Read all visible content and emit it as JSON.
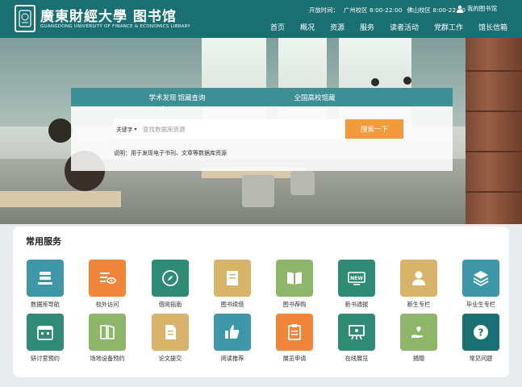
{
  "header": {
    "logo_cn": "廣東財經大學 图书馆",
    "logo_en": "GUANGDONG UNIVERSITY OF FINANCE & ECONOMICS  LIBRARY",
    "hours_label": "开放时间：",
    "hours_campus_1": "广州校区 8:00-22:00",
    "hours_campus_2": "佛山校区 8:00-22:30",
    "user_link": "我的图书馆",
    "nav": [
      "首页",
      "概况",
      "资源",
      "服务",
      "读者活动",
      "党群工作",
      "馆长信箱"
    ]
  },
  "search": {
    "tabs": [
      "学术发现",
      "馆藏查询",
      "全国高校馆藏"
    ],
    "active_tab": 0,
    "select_value": "关键字",
    "input_placeholder": "查找数据库资源",
    "button_label": "搜索一下",
    "hint": "说明：用于发现电子书刊、文章等数据库资源"
  },
  "services": {
    "title": "常用服务",
    "items": [
      {
        "label": "数据库导航",
        "color": "#3e97a6",
        "icon": "database-icon"
      },
      {
        "label": "校外访问",
        "color": "#f0863a",
        "icon": "remote-access-icon"
      },
      {
        "label": "借阅指南",
        "color": "#2f8b73",
        "icon": "compass-icon"
      },
      {
        "label": "图书续借",
        "color": "#d8b46a",
        "icon": "book-icon"
      },
      {
        "label": "图书荐购",
        "color": "#8fb56a",
        "icon": "open-book-icon"
      },
      {
        "label": "新书通报",
        "color": "#2f8b73",
        "icon": "new-badge-icon"
      },
      {
        "label": "新生专栏",
        "color": "#d8b46a",
        "icon": "person-icon"
      },
      {
        "label": "毕业生专栏",
        "color": "#3e97a6",
        "icon": "layers-icon"
      },
      {
        "label": "研讨室预约",
        "color": "#2f8b73",
        "icon": "calendar-icon"
      },
      {
        "label": "场地设备预约",
        "color": "#8fb56a",
        "icon": "equipment-icon"
      },
      {
        "label": "论文提交",
        "color": "#d8b46a",
        "icon": "document-icon"
      },
      {
        "label": "阅读推荐",
        "color": "#3e97a6",
        "icon": "thumbs-up-icon"
      },
      {
        "label": "展览申请",
        "color": "#f0863a",
        "icon": "clipboard-icon"
      },
      {
        "label": "在线展览",
        "color": "#2f8b73",
        "icon": "easel-icon"
      },
      {
        "label": "捐赠",
        "color": "#8fb56a",
        "icon": "donate-heart-icon"
      },
      {
        "label": "常见问题",
        "color": "#1a6f73",
        "icon": "question-icon"
      }
    ]
  }
}
